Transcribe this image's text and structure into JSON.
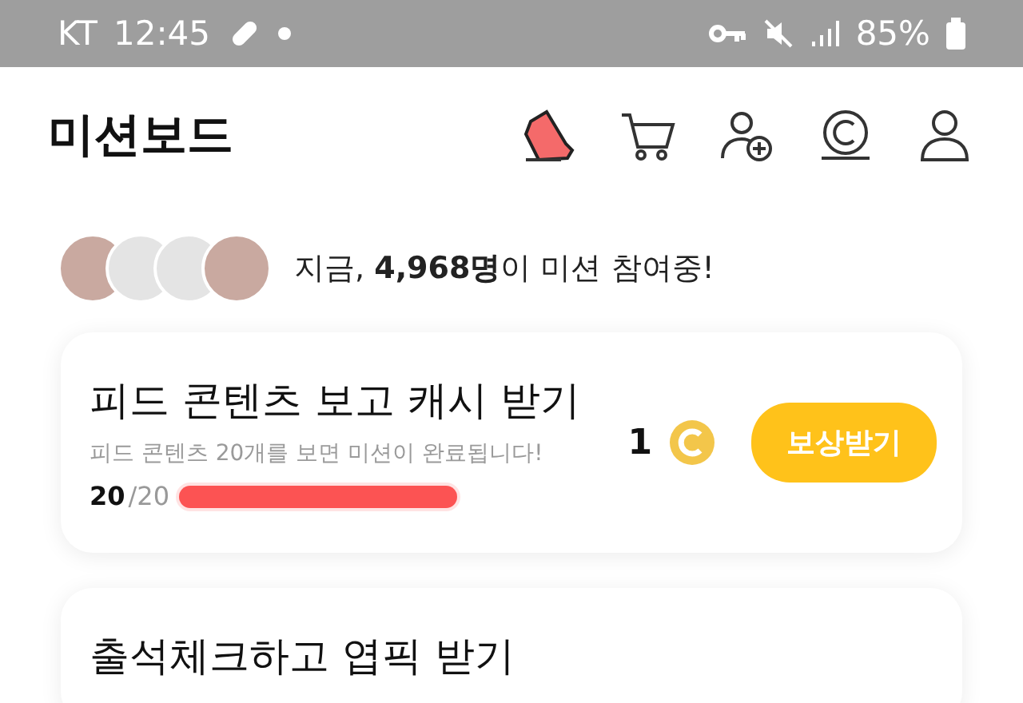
{
  "status_bar": {
    "carrier": "KT",
    "time": "12:45",
    "battery": "85%"
  },
  "header": {
    "title": "미션보드"
  },
  "participants": {
    "prefix": "지금, ",
    "count": "4,968명",
    "suffix": "이 미션 참여중!",
    "avatars": [
      {
        "kind": "photo"
      },
      {
        "kind": "blank"
      },
      {
        "kind": "blank"
      },
      {
        "kind": "photo"
      }
    ]
  },
  "missions": [
    {
      "title": "피드 콘텐츠 보고 캐시 받기",
      "description": "피드 콘텐츠 20개를 보면 미션이 완료됩니다!",
      "done": "20",
      "total": "/20",
      "level": 1,
      "reward": "1",
      "button": "보상받기"
    },
    {
      "title": "출석체크하고 엽픽 받기"
    }
  ]
}
